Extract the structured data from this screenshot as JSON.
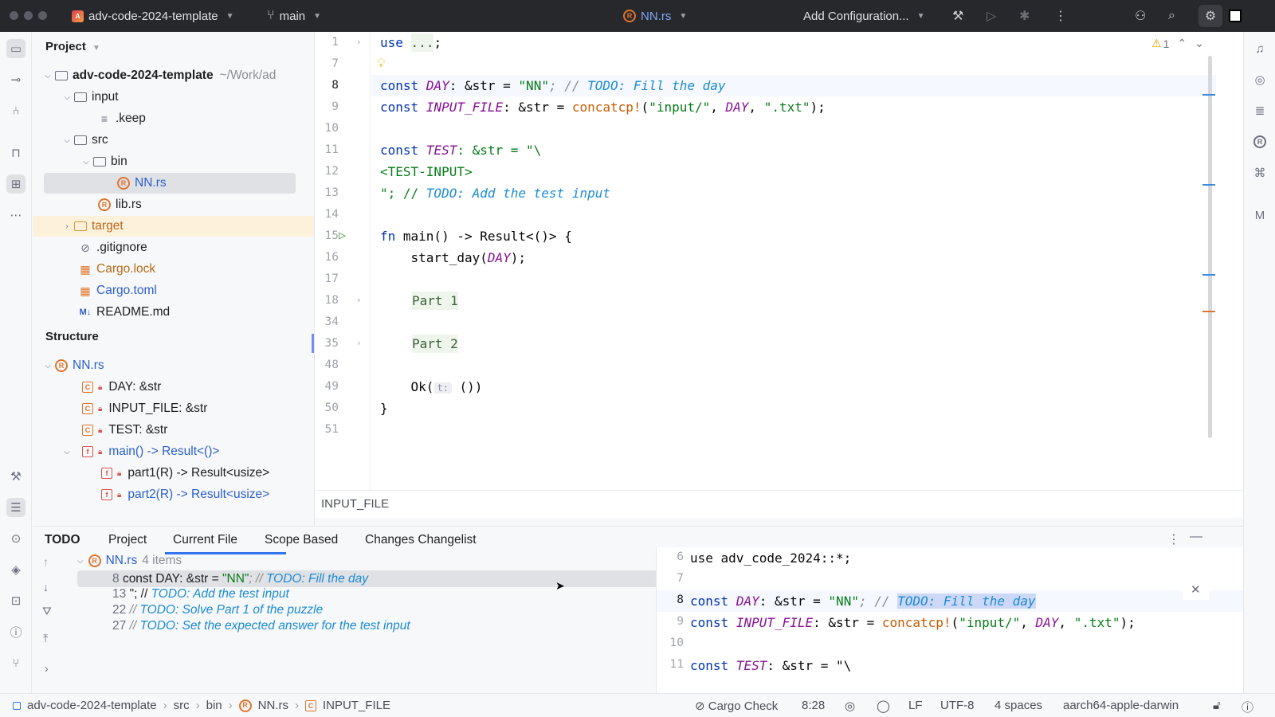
{
  "titlebar": {
    "project_badge": "A",
    "project_name": "adv-code-2024-template",
    "branch": "main",
    "file_badge": "R",
    "file": "NN.rs",
    "run_config": "Add Configuration..."
  },
  "project_panel": {
    "title": "Project",
    "root": "adv-code-2024-template",
    "root_path": "~/Work/ad",
    "items": {
      "input": "input",
      "keep": ".keep",
      "src": "src",
      "bin": "bin",
      "nn": "NN.rs",
      "lib": "lib.rs",
      "target": "target",
      "gitignore": ".gitignore",
      "cargo_lock": "Cargo.lock",
      "cargo_toml": "Cargo.toml",
      "readme": "README.md"
    },
    "rust_badge": "R",
    "md_badge": "M↓"
  },
  "structure_panel": {
    "title": "Structure",
    "file": "NN.rs",
    "const_badge": "C",
    "fn_badge": "f",
    "items": [
      "DAY: &str",
      "INPUT_FILE: &str",
      "TEST: &str"
    ],
    "main": "main() -> Result<()>",
    "part1": "part1(R) -> Result<usize>",
    "part2": "part2(R) -> Result<usize>"
  },
  "editor": {
    "line_numbers": [
      "1",
      "7",
      "8",
      "9",
      "10",
      "11",
      "12",
      "13",
      "14",
      "15",
      "16",
      "17",
      "18",
      "34",
      "35",
      "48",
      "49",
      "50",
      "51"
    ],
    "warning_count": "1",
    "code": {
      "l1_kw": "use",
      "l1_fold": "...",
      "l1_end": ";",
      "const_kw": "const",
      "day": "DAY",
      "str_type": ": &str = ",
      "nn": "\"NN\"",
      "semicomment": "; // ",
      "todo_day": "TODO: Fill the day",
      "input_file": "INPUT_FILE",
      "concat": "concatcp!",
      "paren_open": "(",
      "input_dir": "\"input/\"",
      "comma": ", ",
      "comma2": ", ",
      "txt": "\".txt\"",
      "close": ");",
      "test": "TEST",
      "test_str": ": &str = \"\\",
      "test_input": "<TEST-INPUT>",
      "quote_end": "\"; // ",
      "todo_test": "TODO: Add the test input",
      "fn_kw": "fn",
      "main_sig": " main() -> Result<()> {",
      "start_day": "    start_day(",
      "start_day_end": ");",
      "part1": "Part 1",
      "part2": "Part 2",
      "ok_open": "    Ok(",
      "ok_hint": "t:",
      "ok_close": " ())",
      "brace": "}"
    },
    "breadcrumb": "INPUT_FILE"
  },
  "todo_panel": {
    "tabs": [
      "TODO",
      "Project",
      "Current File",
      "Scope Based",
      "Changes Changelist"
    ],
    "file": "NN.rs",
    "count": "4 items",
    "rows": [
      {
        "line": "8",
        "prefix": "const DAY: &str = ",
        "str": "\"NN\"",
        "mid": "; // ",
        "todo": "TODO: Fill the day"
      },
      {
        "line": "13",
        "prefix": "\"; // ",
        "todo": "TODO: Add the test input"
      },
      {
        "line": "22",
        "prefix": "// ",
        "todo": "TODO: Solve Part 1 of the puzzle"
      },
      {
        "line": "27",
        "prefix": "// ",
        "todo": "TODO: Set the expected answer for the test input"
      }
    ],
    "preview": {
      "line_numbers": [
        "6",
        "7",
        "8",
        "9",
        "10",
        "11"
      ],
      "l6": "use adv_code_2024::*;",
      "l11_end": ": &str = \"\\"
    }
  },
  "statusbar": {
    "crumbs": [
      "adv-code-2024-template",
      "src",
      "bin",
      "NN.rs",
      "INPUT_FILE"
    ],
    "cargo_check": "Cargo Check",
    "position": "8:28",
    "line_sep": "LF",
    "encoding": "UTF-8",
    "indent": "4 spaces",
    "target": "aarch64-apple-darwin"
  }
}
